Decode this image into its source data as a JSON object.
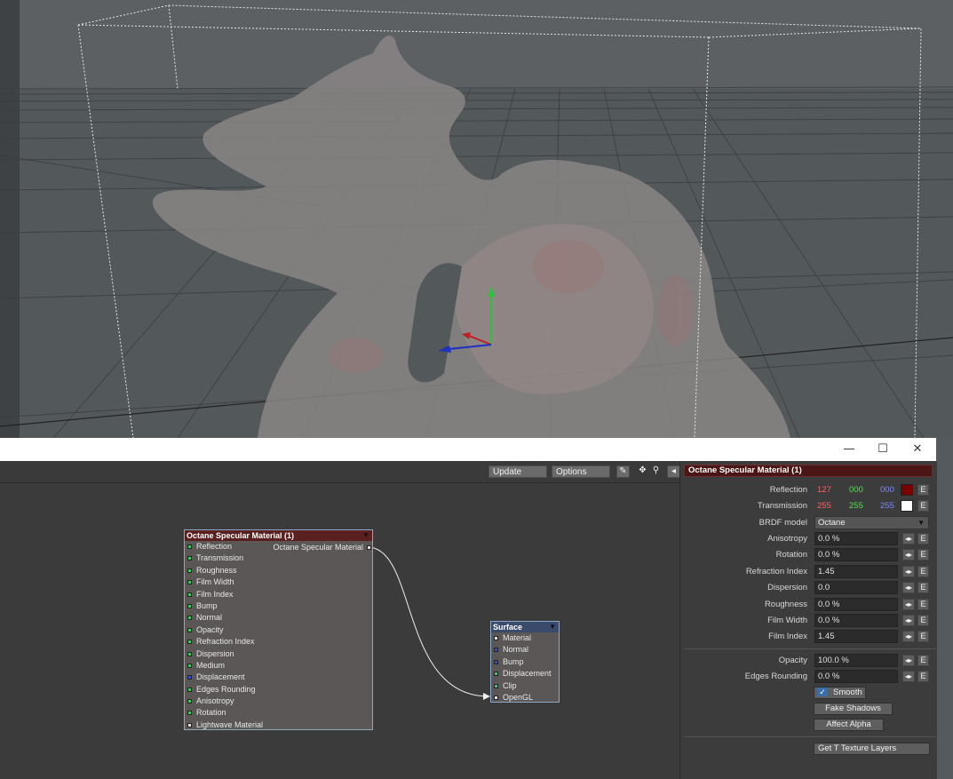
{
  "window": {
    "minimize": "—",
    "maximize": "☐",
    "close": "✕"
  },
  "toolbar": {
    "update_label": "Update",
    "options_label": "Options"
  },
  "nodes": {
    "material": {
      "title": "Octane Specular Material (1)",
      "output_label": "Octane Specular Material",
      "inputs": [
        {
          "label": "Reflection",
          "color": "g"
        },
        {
          "label": "Transmission",
          "color": "g"
        },
        {
          "label": "Roughness",
          "color": "g"
        },
        {
          "label": "Film Width",
          "color": "g"
        },
        {
          "label": "Film Index",
          "color": "g"
        },
        {
          "label": "Bump",
          "color": "g"
        },
        {
          "label": "Normal",
          "color": "g"
        },
        {
          "label": "Opacity",
          "color": "g"
        },
        {
          "label": "Refraction Index",
          "color": "g"
        },
        {
          "label": "Dispersion",
          "color": "g"
        },
        {
          "label": "Medium",
          "color": "g"
        },
        {
          "label": "Displacement",
          "color": "b"
        },
        {
          "label": "Edges Rounding",
          "color": "g"
        },
        {
          "label": "Anisotropy",
          "color": "g"
        },
        {
          "label": "Rotation",
          "color": "g"
        },
        {
          "label": "Lightwave Material",
          "color": "w"
        }
      ]
    },
    "surface": {
      "title": "Surface",
      "inputs": [
        {
          "label": "Material",
          "color": "w"
        },
        {
          "label": "Normal",
          "color": "b"
        },
        {
          "label": "Bump",
          "color": "b"
        },
        {
          "label": "Displacement",
          "color": "g"
        },
        {
          "label": "Clip",
          "color": "g"
        },
        {
          "label": "OpenGL",
          "color": "w"
        }
      ]
    }
  },
  "panel": {
    "title": "Octane Specular Material (1)",
    "reflection": {
      "label": "Reflection",
      "r": "127",
      "g": "000",
      "b": "000",
      "swatch": "#7a0000"
    },
    "transmission": {
      "label": "Transmission",
      "r": "255",
      "g": "255",
      "b": "255",
      "swatch": "#ffffff"
    },
    "brdf": {
      "label": "BRDF model",
      "value": "Octane"
    },
    "fields": [
      {
        "label": "Anisotropy",
        "value": "0.0 %"
      },
      {
        "label": "Rotation",
        "value": "0.0 %"
      },
      {
        "label": "Refraction Index",
        "value": "1.45"
      },
      {
        "label": "Dispersion",
        "value": "0.0"
      },
      {
        "label": "Roughness",
        "value": "0.0 %"
      },
      {
        "label": "Film Width",
        "value": "0.0 %"
      },
      {
        "label": "Film Index",
        "value": "1.45"
      }
    ],
    "opacity": {
      "label": "Opacity",
      "value": "100.0 %"
    },
    "edges": {
      "label": "Edges Rounding",
      "value": "0.0 %"
    },
    "e_label": "E",
    "smooth_label": "Smooth",
    "fake_shadows_label": "Fake Shadows",
    "affect_alpha_label": "Affect Alpha",
    "get_texture_label": "Get T Texture Layers"
  },
  "colors": {
    "red": "#ff6060",
    "green": "#50e050",
    "blue": "#7a8aff"
  }
}
